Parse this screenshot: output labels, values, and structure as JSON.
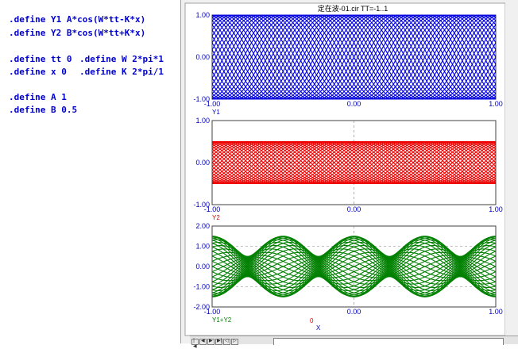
{
  "netlist": {
    "lines": [
      ".define Y1 A*cos(W*tt-K*x)",
      ".define Y2 B*cos(W*tt+K*x)",
      ".define tt 0",
      ".define W 2*pi*1",
      ".define x 0",
      ".define K 2*pi/1",
      ".define A 1",
      ".define B 0.5"
    ]
  },
  "window": {
    "title": "定在波-01.cir TT=-1..1"
  },
  "colors": {
    "y1": "#0000e0",
    "y2": "#ee0000",
    "sum": "#008000",
    "axis_text": "#0000c0",
    "grid": "#808080"
  },
  "chart_data": [
    {
      "type": "line",
      "series": [
        {
          "name": "Y1",
          "expression": "A*cos(W*tt-K*x)",
          "amplitude": 1
        }
      ],
      "xlim": [
        -1,
        1
      ],
      "ylim": [
        -1,
        1
      ],
      "xticks": [
        "-1.00",
        "0.00",
        "1.00"
      ],
      "yticks": [
        "1.00",
        "0.00",
        "-1.00"
      ],
      "xlabel": "Y1"
    },
    {
      "type": "line",
      "series": [
        {
          "name": "Y2",
          "expression": "B*cos(W*tt+K*x)",
          "amplitude": 0.5
        }
      ],
      "xlim": [
        -1,
        1
      ],
      "ylim": [
        -1,
        1
      ],
      "xticks": [
        "-1.00",
        "0.00",
        "1.00"
      ],
      "yticks": [
        "1.00",
        "0.00",
        "-1.00"
      ],
      "xlabel": "Y2"
    },
    {
      "type": "line",
      "series": [
        {
          "name": "Y1+Y2",
          "expression": "Y1+Y2"
        }
      ],
      "xlim": [
        -1,
        1
      ],
      "ylim": [
        -2,
        2
      ],
      "xticks": [
        "-1.00",
        "0.00",
        "1.00"
      ],
      "yticks": [
        "2.00",
        "1.00",
        "0.00",
        "-1.00",
        "-2.00"
      ],
      "xlabel": "Y1+Y2",
      "xvar_label": "X",
      "marker_label": "0"
    }
  ]
}
